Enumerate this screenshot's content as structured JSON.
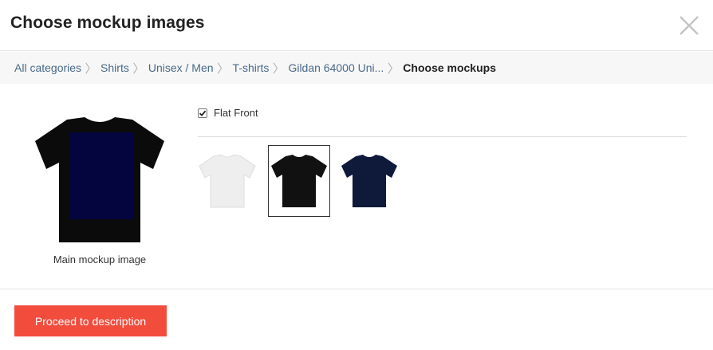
{
  "dialog": {
    "title": "Choose mockup images",
    "close_icon": "close-icon"
  },
  "breadcrumb": {
    "items": [
      "All categories",
      "Shirts",
      "Unisex / Men",
      "T-shirts",
      "Gildan 64000 Uni...",
      "Choose mockups"
    ],
    "separator": "〉"
  },
  "main_mockup": {
    "caption": "Main mockup image",
    "shirt_color": "#0b0b0b",
    "print_area_color": "#04043f"
  },
  "options": {
    "flat_front_label": "Flat Front",
    "flat_front_checked": true
  },
  "thumbnails": [
    {
      "color_name": "white",
      "color": "#eeeeee",
      "selected": false
    },
    {
      "color_name": "black",
      "color": "#111111",
      "selected": true
    },
    {
      "color_name": "navy",
      "color": "#0f1a3a",
      "selected": false
    }
  ],
  "footer": {
    "proceed_label": "Proceed to description",
    "proceed_color": "#f24c3d"
  }
}
